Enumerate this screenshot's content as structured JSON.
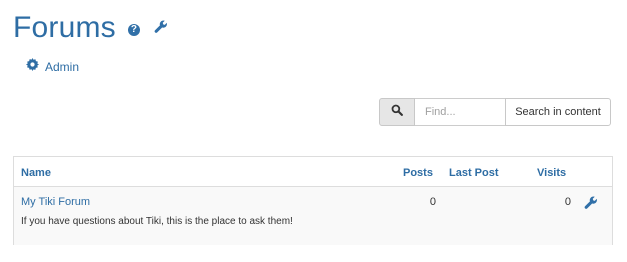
{
  "page": {
    "title": "Forums"
  },
  "admin": {
    "label": "Admin"
  },
  "search": {
    "placeholder": "Find...",
    "button_label": "Search in content"
  },
  "table": {
    "columns": [
      "Name",
      "Posts",
      "Last Post",
      "Visits"
    ],
    "rows": [
      {
        "name": "My Tiki Forum",
        "description": "If you have questions about Tiki, this is the place to ask them!",
        "posts": "0",
        "last_post": "",
        "visits": "0"
      }
    ]
  },
  "icons": {
    "help": "question-circle-icon",
    "wrench": "wrench-icon",
    "gear": "gear-icon",
    "search": "search-icon"
  },
  "colors": {
    "link": "#2e6da4",
    "text": "#333333",
    "border": "#dddddd",
    "row_bg": "#f9f9f9"
  }
}
